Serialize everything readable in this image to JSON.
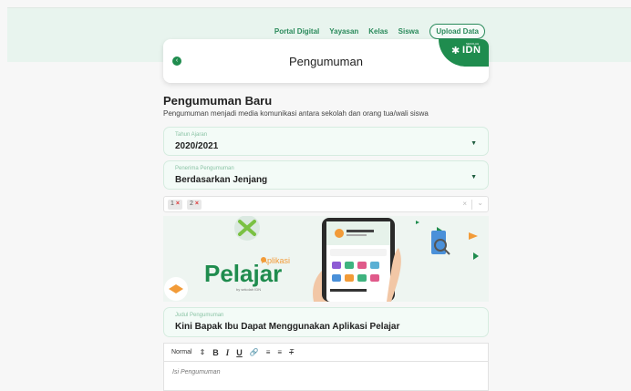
{
  "nav": {
    "links": [
      "Portal Digital",
      "Yayasan",
      "Kelas",
      "Siswa"
    ],
    "upload_label": "Upload Data"
  },
  "header": {
    "title": "Pengumuman",
    "brand": "IDN",
    "brand_small": "SEKOLAH"
  },
  "form": {
    "title": "Pengumuman Baru",
    "subtitle": "Pengumuman menjadi media komunikasi antara sekolah dan orang tua/wali siswa",
    "tahun_ajaran": {
      "label": "Tahun Ajaran",
      "value": "2020/2021"
    },
    "penerima": {
      "label": "Penerima Pengumuman",
      "value": "Berdasarkan Jenjang"
    },
    "jenjang_chips": [
      "1",
      "2"
    ],
    "judul": {
      "label": "Judul Pengumuman",
      "value": "Kini Bapak Ibu Dapat Menggunakan Aplikasi Pelajar"
    },
    "editor": {
      "format": "Normal",
      "placeholder": "Isi Pengumuman"
    }
  },
  "banner": {
    "small_title": "Aplikasi",
    "big_title": "Pelajar",
    "byline": "by sekolah IDN",
    "phone_header": "Hello Papa Ibu Budi"
  },
  "colors": {
    "primary": "#1f8c4e",
    "accent": "#2a8a5b",
    "field_bg": "#f3fbf7"
  }
}
